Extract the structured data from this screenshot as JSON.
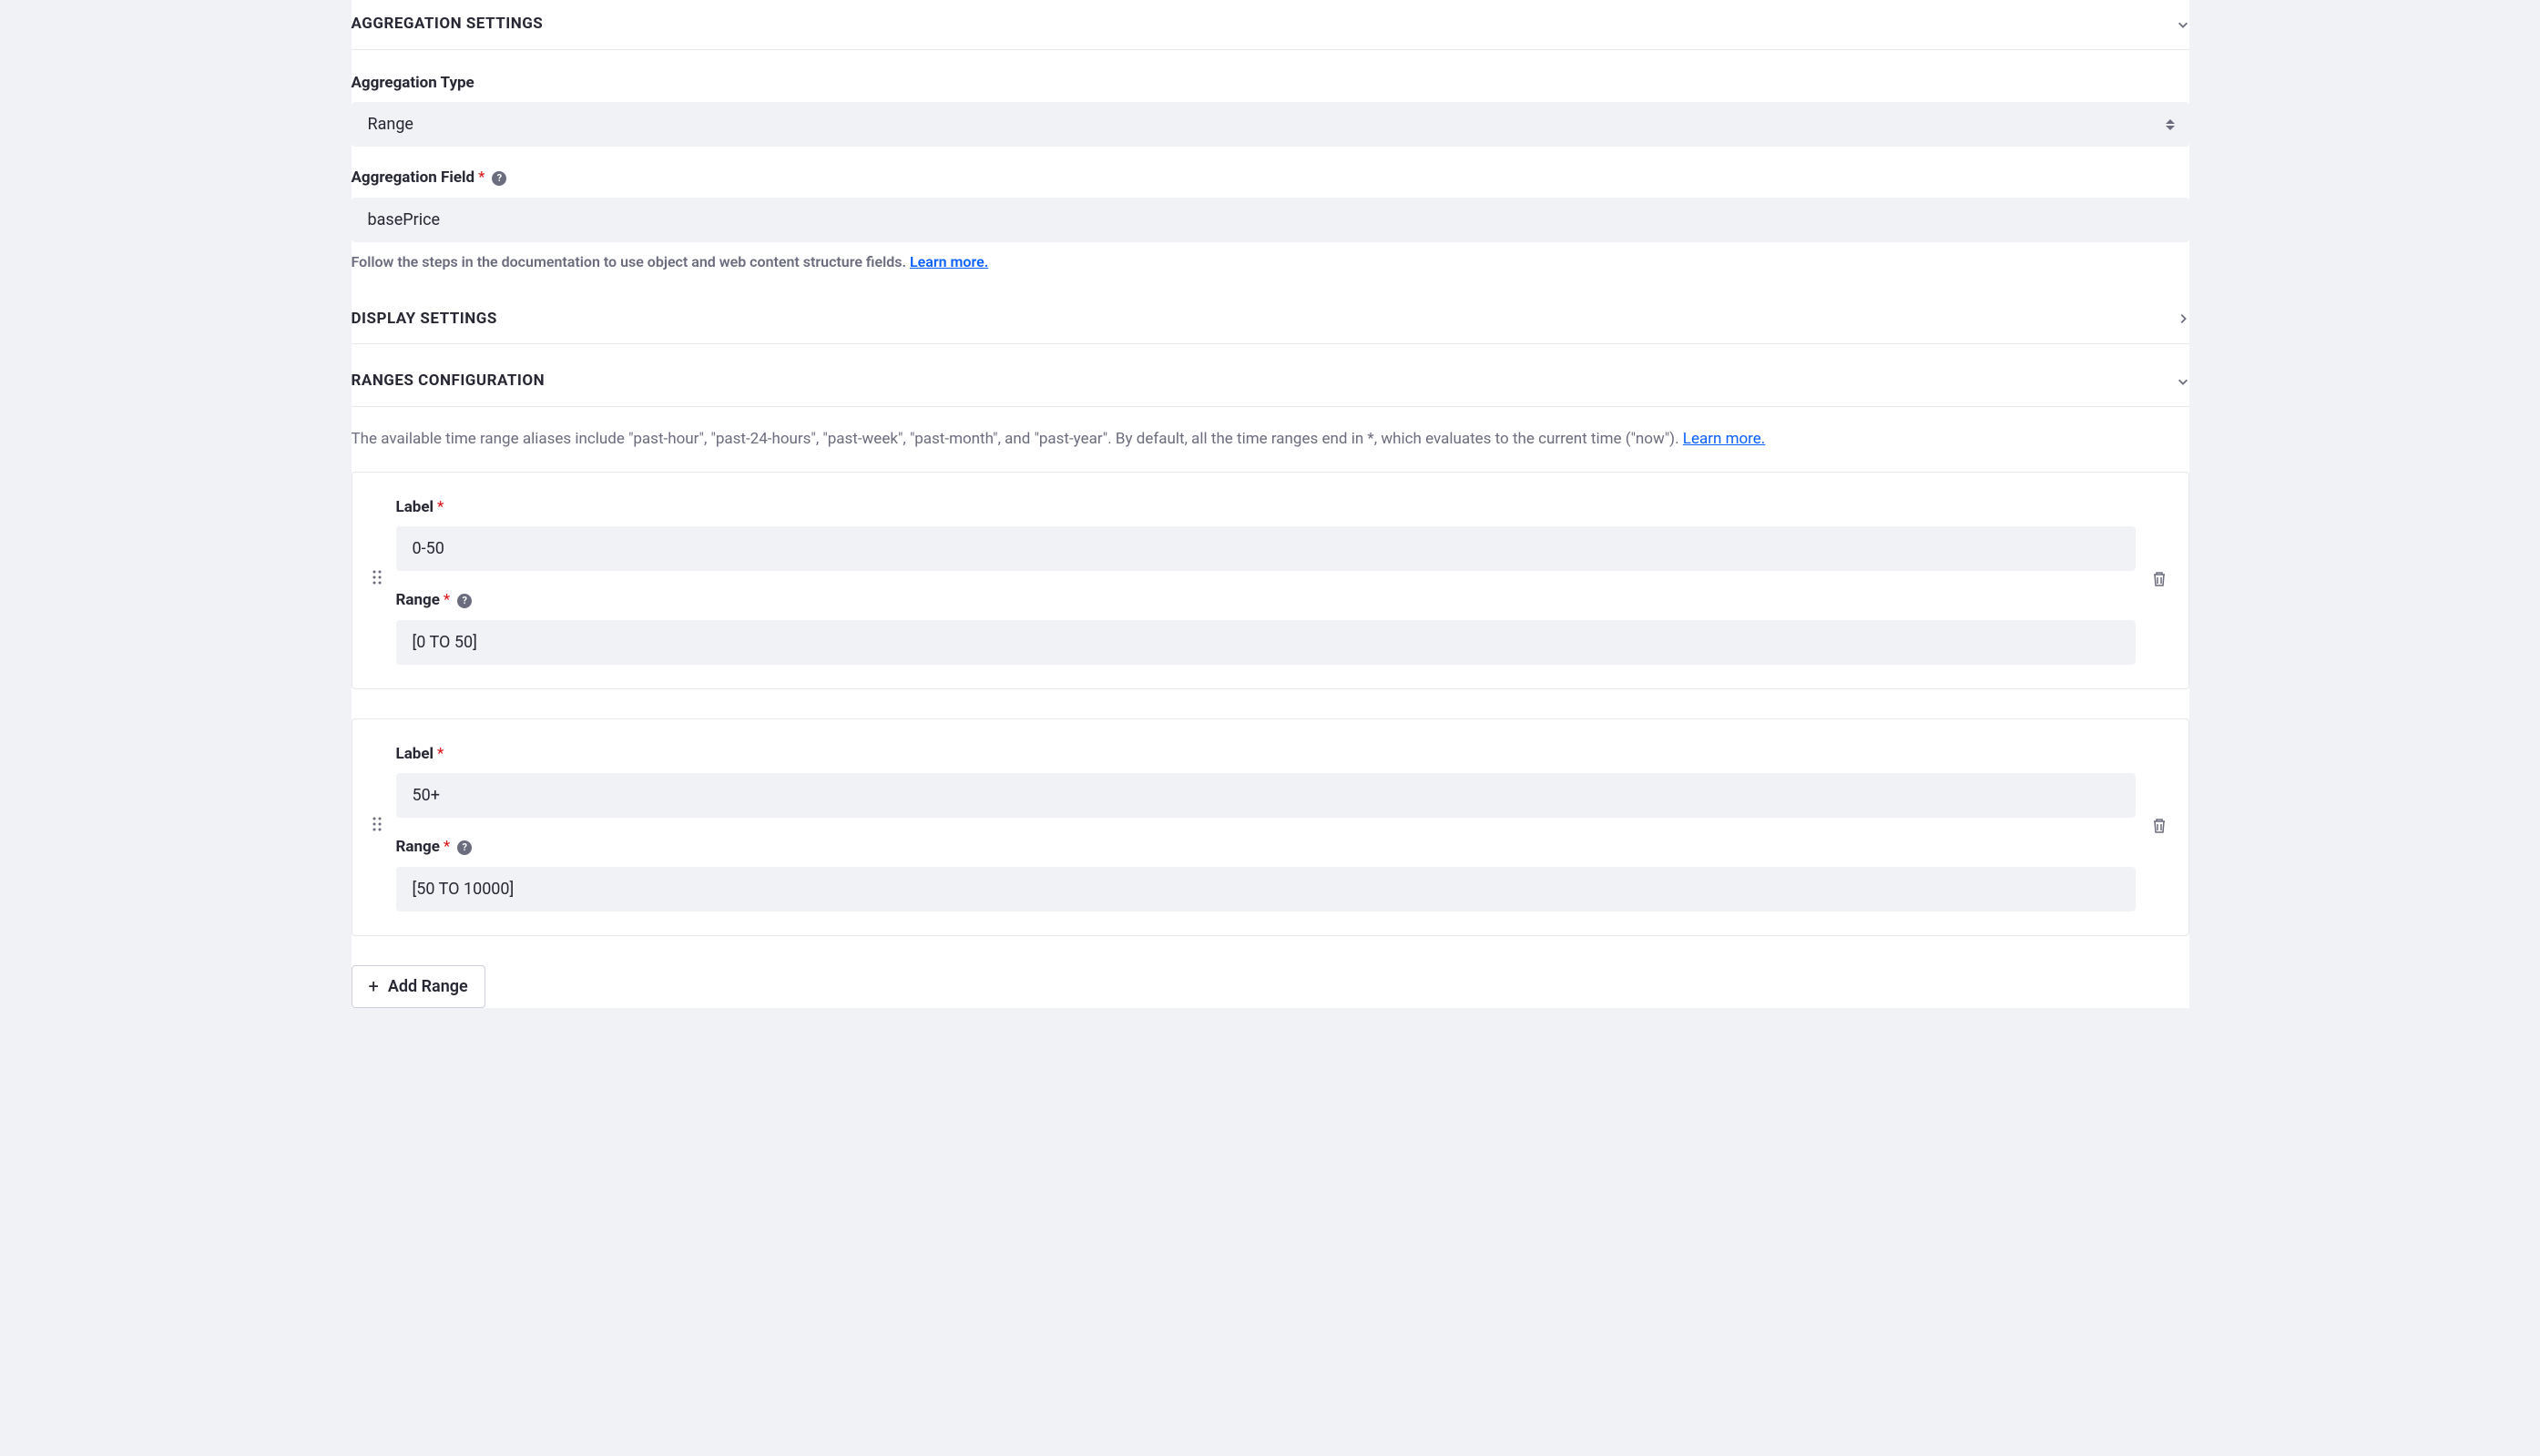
{
  "sections": {
    "aggregation": {
      "title": "AGGREGATION SETTINGS",
      "type_label": "Aggregation Type",
      "type_value": "Range",
      "field_label": "Aggregation Field",
      "field_value": "basePrice",
      "help_text": "Follow the steps in the documentation to use object and web content structure fields. ",
      "learn_more": "Learn more."
    },
    "display": {
      "title": "DISPLAY SETTINGS"
    },
    "ranges": {
      "title": "RANGES CONFIGURATION",
      "description": "The available time range aliases include \"past-hour\", \"past-24-hours\", \"past-week\", \"past-month\", and \"past-year\". By default, all the time ranges end in *, which evaluates to the current time (\"now\"). ",
      "learn_more": "Learn more.",
      "label_label": "Label",
      "range_label": "Range",
      "items": [
        {
          "label": "0-50",
          "range": "[0 TO 50]"
        },
        {
          "label": "50+",
          "range": "[50 TO 10000]"
        }
      ],
      "add_button": "Add Range"
    }
  }
}
